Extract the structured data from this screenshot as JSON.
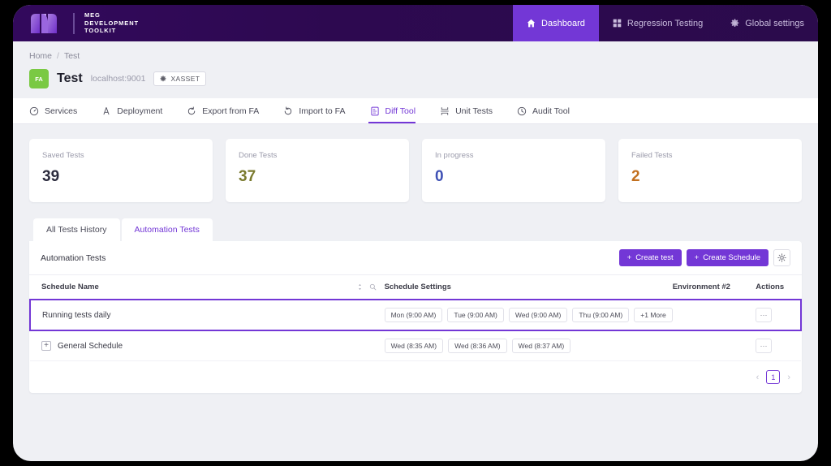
{
  "brand": {
    "line1": "MEG",
    "line2": "DEVELOPMENT",
    "line3": "TOOLKIT",
    "logo_icon": "meg-logo-icon"
  },
  "topnav": {
    "items": [
      {
        "label": "Dashboard",
        "icon": "home-icon",
        "active": true
      },
      {
        "label": "Regression Testing",
        "icon": "grid-icon",
        "active": false
      },
      {
        "label": "Global settings",
        "icon": "gear-icon",
        "active": false
      }
    ],
    "active_bg": "#7337d6",
    "bar_bg": "#2d0950"
  },
  "breadcrumb": {
    "home": "Home",
    "separator": "/",
    "current": "Test"
  },
  "header": {
    "badge": "FA",
    "badge_color": "#7ac943",
    "title": "Test",
    "host": "localhost:9001",
    "tag": "XASSET",
    "tag_icon": "gear-icon"
  },
  "section_tabs": [
    {
      "label": "Services",
      "icon": "speedometer-icon",
      "active": false
    },
    {
      "label": "Deployment",
      "icon": "sitemap-icon",
      "active": false
    },
    {
      "label": "Export from FA",
      "icon": "export-icon",
      "active": false
    },
    {
      "label": "Import to FA",
      "icon": "import-icon",
      "active": false
    },
    {
      "label": "Diff Tool",
      "icon": "diff-icon",
      "active": true
    },
    {
      "label": "Unit Tests",
      "icon": "unit-tests-icon",
      "active": false
    },
    {
      "label": "Audit Tool",
      "icon": "clock-icon",
      "active": false
    }
  ],
  "stats": [
    {
      "label": "Saved Tests",
      "value": "39",
      "color": "#2b2b3d"
    },
    {
      "label": "Done Tests",
      "value": "37",
      "color": "#7a7a2e"
    },
    {
      "label": "In progress",
      "value": "0",
      "color": "#3f51b5"
    },
    {
      "label": "Failed Tests",
      "value": "2",
      "color": "#c2701f"
    }
  ],
  "panel_tabs": [
    {
      "label": "All Tests History",
      "active": false
    },
    {
      "label": "Automation Tests",
      "active": true
    }
  ],
  "panel": {
    "title": "Automation Tests",
    "create_test_label": "Create test",
    "create_schedule_label": "Create Schedule",
    "settings_icon": "gear-icon",
    "accent": "#7337d6"
  },
  "table": {
    "columns": [
      {
        "label": "Schedule Name"
      },
      {
        "label": "Schedule Settings"
      },
      {
        "label": "Environment #2"
      },
      {
        "label": "Actions"
      }
    ],
    "header_tools": {
      "sort_icon": "sort-icon",
      "search_icon": "search-icon"
    },
    "rows": [
      {
        "name": "Running tests daily",
        "expandable": false,
        "selected": true,
        "chips": [
          "Mon (9:00 AM)",
          "Tue (9:00 AM)",
          "Wed (9:00 AM)",
          "Thu (9:00 AM)",
          "+1 More"
        ],
        "environment": "",
        "actions": "⋯"
      },
      {
        "name": "General Schedule",
        "expandable": true,
        "expand_icon": "plus-square-icon",
        "selected": false,
        "chips": [
          "Wed (8:35 AM)",
          "Wed (8:36 AM)",
          "Wed (8:37 AM)"
        ],
        "environment": "",
        "actions": "⋯"
      }
    ]
  },
  "pagination": {
    "prev": "‹",
    "page": "1",
    "next": "›"
  }
}
